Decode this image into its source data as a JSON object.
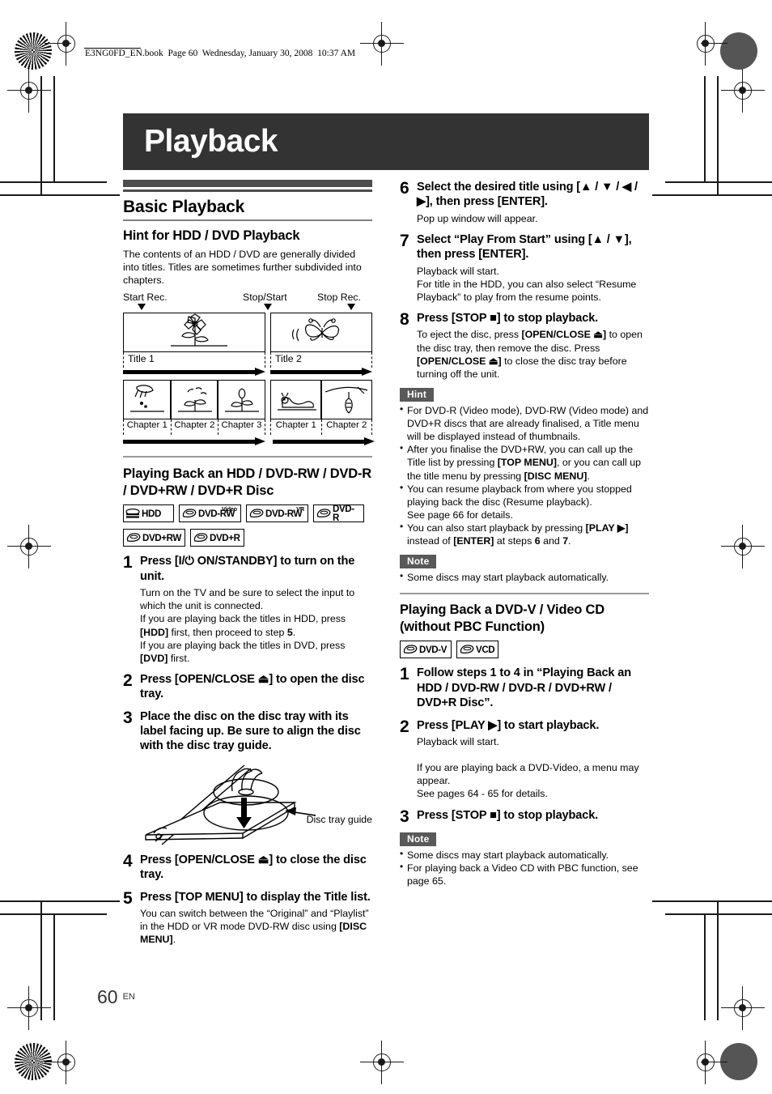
{
  "file_header": "E3NG0FD_EN.book  Page 60  Wednesday, January 30, 2008  10:37 AM",
  "chapter": {
    "title": "Playback"
  },
  "footer": {
    "page_number": "60",
    "language": "EN"
  },
  "left": {
    "section_title": "Basic Playback",
    "hint_subtitle": "Hint for HDD / DVD Playback",
    "hint_text": "The contents of an HDD / DVD are generally divided into titles. Titles are sometimes further subdivided into chapters.",
    "diagram": {
      "marker_labels": [
        "Start Rec.",
        "Stop/Start",
        "Stop Rec."
      ],
      "titles": [
        "Title 1",
        "Title 2"
      ],
      "chapters_title1": [
        "Chapter 1",
        "Chapter 2",
        "Chapter 3"
      ],
      "chapters_title2": [
        "Chapter 1",
        "Chapter 2"
      ]
    },
    "playing_back_subtitle": "Playing Back an HDD / DVD-RW / DVD-R / DVD+RW / DVD+R Disc",
    "badges_row1": [
      {
        "label": "HDD",
        "sup": ""
      },
      {
        "label": "DVD-RW",
        "sup": "Video"
      },
      {
        "label": "DVD-RW",
        "sup": "VR"
      },
      {
        "label": "DVD-R",
        "sup": ""
      }
    ],
    "badges_row2": [
      {
        "label": "DVD+RW",
        "sup": ""
      },
      {
        "label": "DVD+R",
        "sup": ""
      }
    ],
    "steps": [
      {
        "num": "1",
        "head": "Press [I/⏻ ON/STANDBY] to turn on the unit.",
        "body_html": "Turn on the TV and be sure to select the input to which the unit is connected.<br>If you are playing back the titles in HDD, press <b>[HDD]</b> first, then proceed to step <b>5</b>.<br>If you are playing back the titles in DVD, press <b>[DVD]</b> first."
      },
      {
        "num": "2",
        "head": "Press [OPEN/CLOSE ⏏] to open the disc tray.",
        "body_html": ""
      },
      {
        "num": "3",
        "head": "Place the disc on the disc tray with its label facing up. Be sure to align the disc with the disc tray guide.",
        "body_html": ""
      },
      {
        "num": "4",
        "head": "Press [OPEN/CLOSE ⏏] to close the disc tray.",
        "body_html": ""
      },
      {
        "num": "5",
        "head": "Press [TOP MENU] to display the Title list.",
        "body_html": "You can switch between the “Original” and “Playlist” in the HDD or VR mode DVD-RW disc using <b>[DISC MENU]</b>."
      }
    ],
    "tray_caption": "Disc tray guide"
  },
  "right": {
    "steps": [
      {
        "num": "6",
        "head": "Select the desired title using [▲ / ▼ / ◀ / ▶], then press [ENTER].",
        "body_html": "Pop up window will appear."
      },
      {
        "num": "7",
        "head": "Select “Play From Start” using [▲ / ▼], then press [ENTER].",
        "body_html": "Playback will start.<br>For title in the HDD, you can also select “Resume Playback” to play from the resume points."
      },
      {
        "num": "8",
        "head": "Press [STOP ■] to stop playback.",
        "body_html": "To eject the disc, press <b>[OPEN/CLOSE ⏏]</b> to open the disc tray, then remove the disc. Press <b>[OPEN/CLOSE ⏏]</b> to close the disc tray before turning off the unit."
      }
    ],
    "hint_tag": "Hint",
    "hint_bullets_html": [
      "For DVD-R (Video mode), DVD-RW (Video mode) and DVD+R discs that are already finalised, a Title menu will be displayed instead of thumbnails.",
      "After you finalise the DVD+RW, you can call up the Title list by pressing <b>[TOP MENU]</b>, or you can call up the title menu by pressing <b>[DISC MENU]</b>.",
      "You can resume playback from where you stopped playing back the disc (Resume playback).<br>See page 66 for details.",
      "You can also start playback by pressing <b>[PLAY ▶]</b> instead of <b>[ENTER]</b> at steps <b>6</b> and <b>7</b>."
    ],
    "note_tag_1": "Note",
    "note_bullets_1_html": [
      "Some discs may start playback automatically."
    ],
    "dvdv_subtitle": "Playing Back a DVD-V / Video CD (without PBC Function)",
    "dvdv_badges": [
      {
        "label": "DVD-V",
        "sup": ""
      },
      {
        "label": "VCD",
        "sup": ""
      }
    ],
    "dvdv_steps": [
      {
        "num": "1",
        "head": "Follow steps 1 to 4 in “Playing Back an HDD / DVD-RW / DVD-R / DVD+RW / DVD+R Disc”.",
        "body_html": ""
      },
      {
        "num": "2",
        "head": "Press [PLAY ▶] to start playback.",
        "body_html": "Playback will start.<br><br>If you are playing back a DVD-Video, a menu may appear.<br>See pages 64 - 65 for details."
      },
      {
        "num": "3",
        "head": "Press [STOP ■] to stop playback.",
        "body_html": ""
      }
    ],
    "note_tag_2": "Note",
    "note_bullets_2_html": [
      "Some discs may start playback automatically.",
      "For playing back a Video CD with PBC function, see page 65."
    ]
  }
}
